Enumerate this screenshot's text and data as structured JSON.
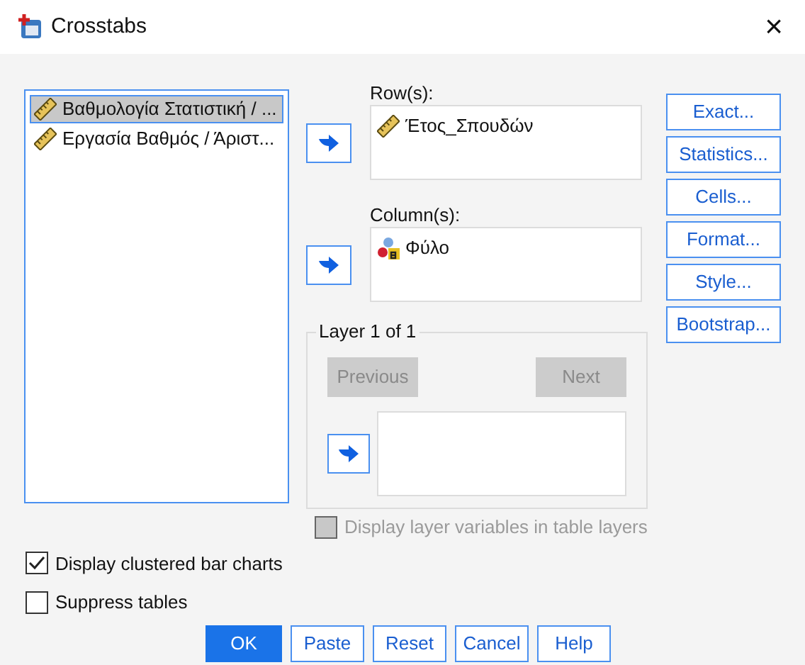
{
  "window": {
    "title": "Crosstabs",
    "close": "×"
  },
  "source_list": [
    {
      "label": "Βαθμολογία Στατιστική / ...",
      "selected": true
    },
    {
      "label": "Εργασία Βαθμός / Άριστ...",
      "selected": false
    }
  ],
  "rows": {
    "label": "Row(s):",
    "items": [
      {
        "label": "Έτος_Σπουδών",
        "kind": "scale"
      }
    ]
  },
  "columns": {
    "label": "Column(s):",
    "items": [
      {
        "label": "Φύλο",
        "kind": "nominal"
      }
    ]
  },
  "layer": {
    "title": "Layer 1 of 1",
    "previous": {
      "label": "Previous",
      "disabled": true
    },
    "next": {
      "label": "Next",
      "disabled": true
    }
  },
  "side_buttons": [
    "Exact...",
    "Statistics...",
    "Cells...",
    "Format...",
    "Style...",
    "Bootstrap..."
  ],
  "checkboxes": [
    {
      "label": "Display layer variables in table layers",
      "checked": false,
      "disabled": true
    },
    {
      "label": "Display clustered bar charts",
      "checked": true,
      "disabled": false
    },
    {
      "label": "Suppress tables",
      "checked": false,
      "disabled": false
    }
  ],
  "buttons": [
    {
      "label": "OK",
      "default": true
    },
    {
      "label": "Paste",
      "default": false
    },
    {
      "label": "Reset",
      "default": false
    },
    {
      "label": "Cancel",
      "default": false
    },
    {
      "label": "Help",
      "default": false
    }
  ]
}
